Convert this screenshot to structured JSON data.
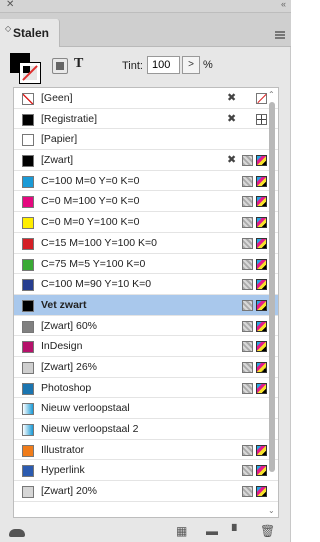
{
  "panel": {
    "close_glyph": "✕",
    "collapse_glyph": "«",
    "tab_arrows": "◇",
    "tab_label": "Stalen",
    "menu_icon": "panel-menu-icon"
  },
  "controls": {
    "tint_label": "Tint:",
    "tint_value": "100",
    "tint_arrow": ">",
    "tint_unit": "%",
    "text_button": "T"
  },
  "swatches": [
    {
      "name": "[Geen]",
      "color": "none",
      "icons": [
        "noedit",
        "none-mode"
      ]
    },
    {
      "name": "[Registratie]",
      "color": "#000000",
      "icons": [
        "noedit",
        "registration"
      ]
    },
    {
      "name": "[Papier]",
      "color": "#ffffff",
      "icons": []
    },
    {
      "name": "[Zwart]",
      "color": "#000000",
      "icons": [
        "noedit",
        "process",
        "cmyk"
      ]
    },
    {
      "name": "C=100 M=0 Y=0 K=0",
      "color": "#1a9ad6",
      "icons": [
        "process",
        "cmyk"
      ]
    },
    {
      "name": "C=0 M=100 Y=0 K=0",
      "color": "#e5087f",
      "icons": [
        "process",
        "cmyk"
      ]
    },
    {
      "name": "C=0 M=0 Y=100 K=0",
      "color": "#ffee00",
      "icons": [
        "process",
        "cmyk"
      ]
    },
    {
      "name": "C=15 M=100 Y=100 K=0",
      "color": "#d41f26",
      "icons": [
        "process",
        "cmyk"
      ]
    },
    {
      "name": "C=75 M=5 Y=100 K=0",
      "color": "#3aaa35",
      "icons": [
        "process",
        "cmyk"
      ]
    },
    {
      "name": "C=100 M=90 Y=10 K=0",
      "color": "#263d8f",
      "icons": [
        "process",
        "cmyk"
      ]
    },
    {
      "name": "Vet zwart",
      "color": "#000000",
      "icons": [
        "process",
        "cmyk"
      ],
      "selected": true
    },
    {
      "name": "[Zwart] 60%",
      "color": "#808080",
      "icons": [
        "process",
        "cmyk"
      ]
    },
    {
      "name": "InDesign",
      "color": "#b5126b",
      "icons": [
        "process",
        "cmyk"
      ]
    },
    {
      "name": "[Zwart] 26%",
      "color": "#cfcfcf",
      "icons": [
        "process",
        "cmyk"
      ]
    },
    {
      "name": "Photoshop",
      "color": "#1b75b0",
      "icons": [
        "process",
        "cmyk"
      ]
    },
    {
      "name": "Nieuw verloopstaal",
      "color": "gradient",
      "icons": []
    },
    {
      "name": "Nieuw verloopstaal 2",
      "color": "gradient",
      "icons": []
    },
    {
      "name": "Illustrator",
      "color": "#f07c1a",
      "icons": [
        "process",
        "cmyk"
      ]
    },
    {
      "name": "Hyperlink",
      "color": "#2b5bb0",
      "icons": [
        "process",
        "cmyk"
      ]
    },
    {
      "name": "[Zwart] 20%",
      "color": "#d6d6d6",
      "icons": [
        "process",
        "cmyk"
      ]
    }
  ],
  "footer_icons": [
    "cc-libraries-icon",
    "show-swatch-views-icon",
    "new-color-group-icon",
    "new-swatch-icon",
    "delete-swatch-icon"
  ]
}
